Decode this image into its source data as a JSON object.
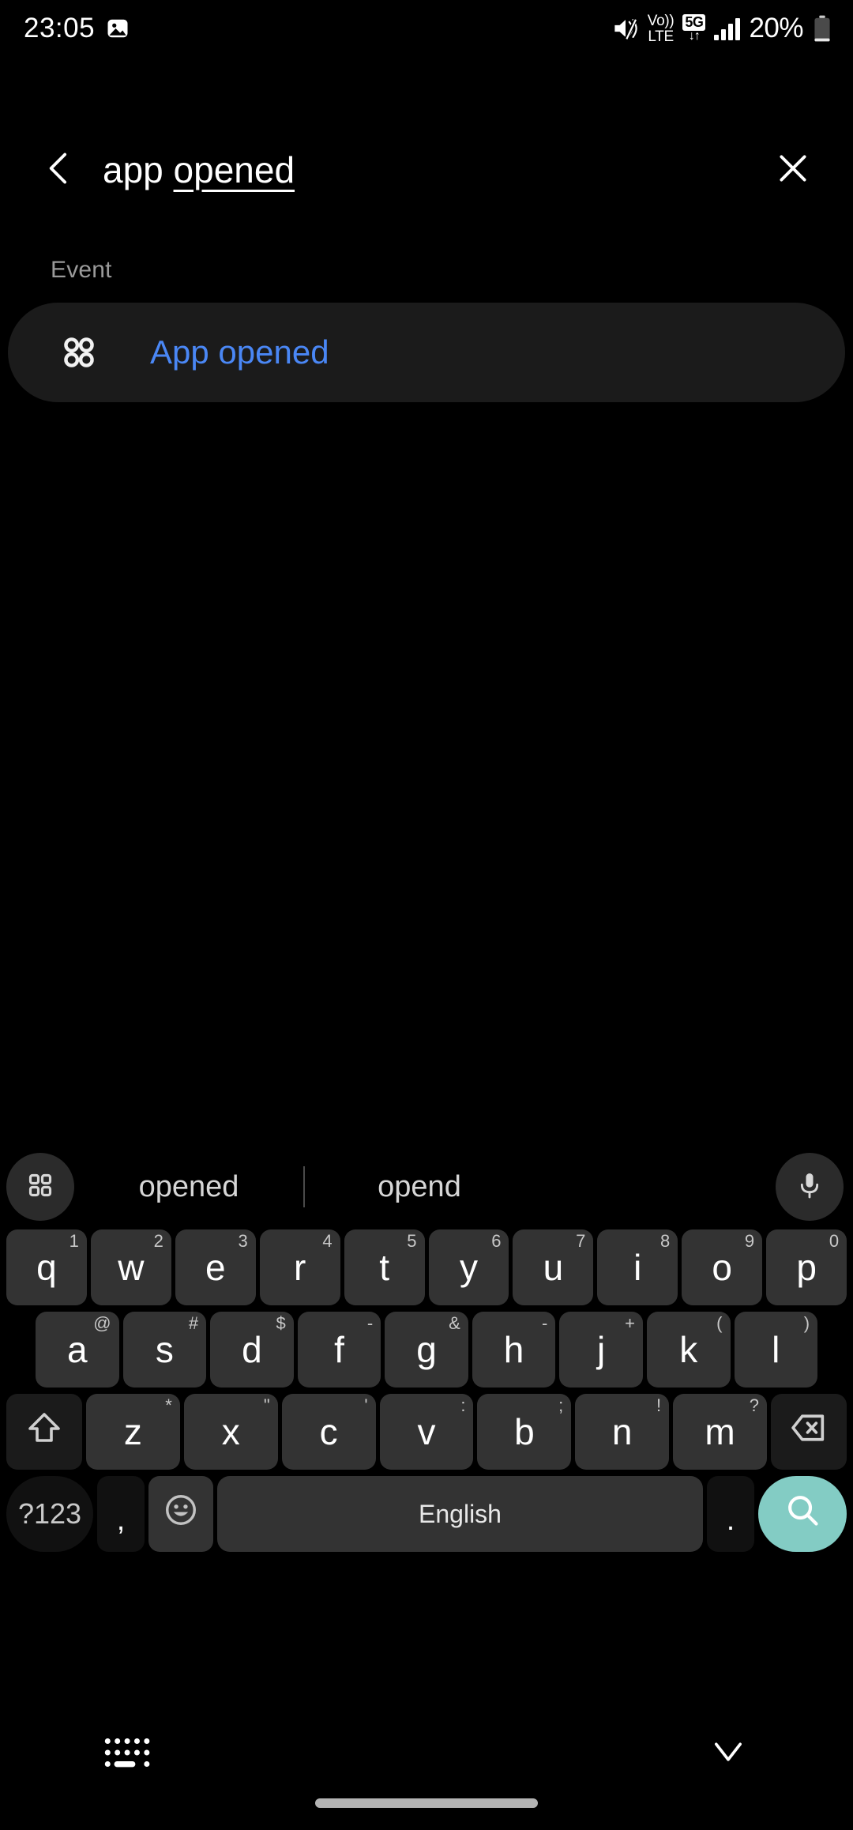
{
  "status_bar": {
    "time": "23:05",
    "battery_percent": "20%",
    "icons": [
      "photo-icon",
      "mute-icon",
      "volte-icon",
      "5g-icon",
      "signal-icon",
      "battery-icon"
    ],
    "volte_line1": "Vo))",
    "volte_line2": "LTE",
    "network_label": "5G",
    "network_arrows": "↓↑"
  },
  "header": {
    "back_icon": "chevron-left-icon",
    "clear_icon": "close-icon",
    "query_committed": "app ",
    "query_composing": "opened",
    "query_full": "app opened"
  },
  "results": {
    "section_label": "Event",
    "items": [
      {
        "icon": "apps-grid-icon",
        "label": "App opened",
        "color": "#4a87f5"
      }
    ]
  },
  "keyboard": {
    "suggestions": {
      "grid_icon": "keyboard-toolbar-grid-icon",
      "mic_icon": "microphone-icon",
      "words": [
        "opened",
        "opend"
      ]
    },
    "row1": [
      {
        "key": "q",
        "alt": "1"
      },
      {
        "key": "w",
        "alt": "2"
      },
      {
        "key": "e",
        "alt": "3"
      },
      {
        "key": "r",
        "alt": "4"
      },
      {
        "key": "t",
        "alt": "5"
      },
      {
        "key": "y",
        "alt": "6"
      },
      {
        "key": "u",
        "alt": "7"
      },
      {
        "key": "i",
        "alt": "8"
      },
      {
        "key": "o",
        "alt": "9"
      },
      {
        "key": "p",
        "alt": "0"
      }
    ],
    "row2": [
      {
        "key": "a",
        "alt": "@"
      },
      {
        "key": "s",
        "alt": "#"
      },
      {
        "key": "d",
        "alt": "$"
      },
      {
        "key": "f",
        "alt": "-"
      },
      {
        "key": "g",
        "alt": "&"
      },
      {
        "key": "h",
        "alt": "-"
      },
      {
        "key": "j",
        "alt": "+"
      },
      {
        "key": "k",
        "alt": "("
      },
      {
        "key": "l",
        "alt": ")"
      }
    ],
    "row3": [
      {
        "key": "z",
        "alt": "*"
      },
      {
        "key": "x",
        "alt": "\""
      },
      {
        "key": "c",
        "alt": "'"
      },
      {
        "key": "v",
        "alt": ":"
      },
      {
        "key": "b",
        "alt": ";"
      },
      {
        "key": "n",
        "alt": "!"
      },
      {
        "key": "m",
        "alt": "?"
      }
    ],
    "shift_icon": "shift-arrow-icon",
    "backspace_icon": "backspace-icon",
    "row4": {
      "symbols_label": "?123",
      "comma_label": ",",
      "emoji_icon": "emoji-face-icon",
      "space_label": "English",
      "period_label": ".",
      "enter_icon": "search-icon",
      "enter_color": "#83ccc4"
    }
  },
  "nav_bar": {
    "keyboard_switch_icon": "keyboard-switcher-icon",
    "hide_keyboard_icon": "chevron-down-icon",
    "home_indicator": "home-indicator-pill"
  }
}
